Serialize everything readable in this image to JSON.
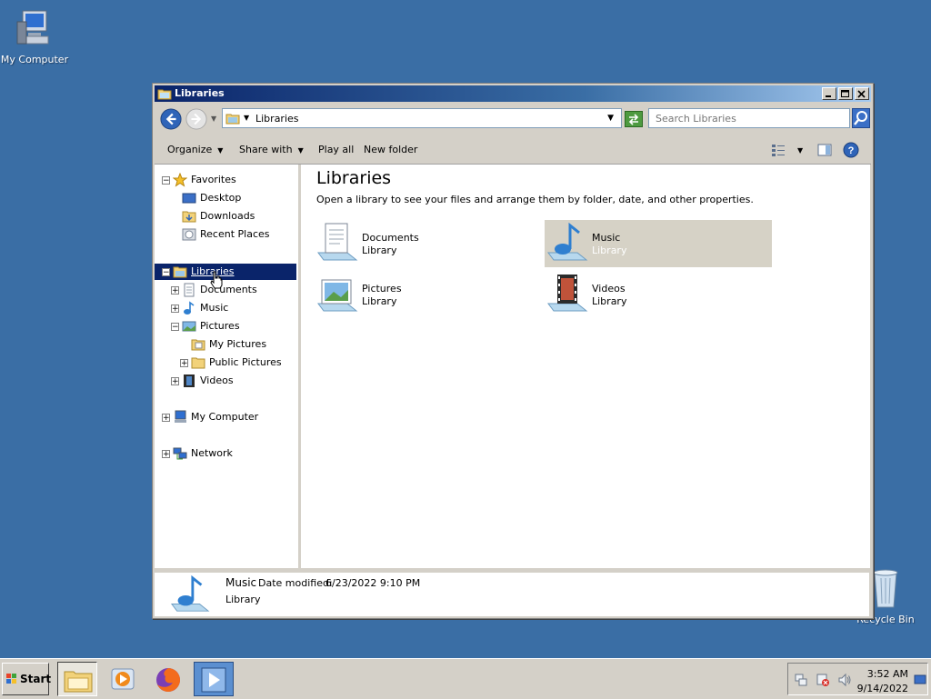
{
  "desktop": {
    "my_computer_label": "My Computer",
    "recycle_bin_label": "Recycle Bin"
  },
  "window": {
    "title": "Libraries",
    "address_crumb": "Libraries",
    "search_placeholder": "Search Libraries",
    "toolbar": {
      "organize": "Organize",
      "share_with": "Share with",
      "play_all": "Play all",
      "new_folder": "New folder"
    },
    "nav": {
      "favorites": "Favorites",
      "desktop": "Desktop",
      "downloads": "Downloads",
      "recent_places": "Recent Places",
      "libraries": "Libraries",
      "documents": "Documents",
      "music": "Music",
      "pictures": "Pictures",
      "my_pictures": "My Pictures",
      "public_pictures": "Public Pictures",
      "videos": "Videos",
      "my_computer": "My Computer",
      "network": "Network"
    },
    "content": {
      "heading": "Libraries",
      "subtitle": "Open a library to see your files and arrange them by folder, date, and other properties.",
      "libraries": [
        {
          "name": "Documents",
          "type": "Library"
        },
        {
          "name": "Music",
          "type": "Library"
        },
        {
          "name": "Pictures",
          "type": "Library"
        },
        {
          "name": "Videos",
          "type": "Library"
        }
      ]
    },
    "details": {
      "name": "Music",
      "date_label": "Date modified:",
      "date_value": "6/23/2022 9:10 PM",
      "type": "Library"
    }
  },
  "taskbar": {
    "start_label": "Start",
    "time": "3:52 AM",
    "date": "9/14/2022"
  },
  "colors": {
    "desktop": "#3a6ea5",
    "title_active": "#0a246a",
    "selection": "#0a246a"
  }
}
